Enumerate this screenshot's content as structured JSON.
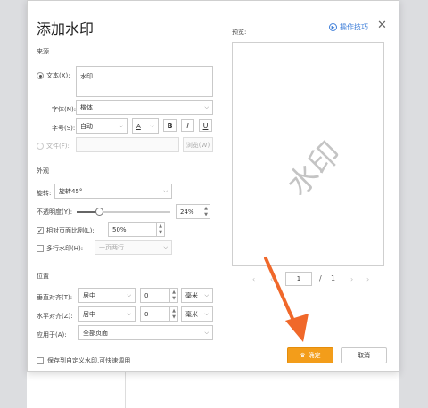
{
  "dialog": {
    "title": "添加水印",
    "help_label": "操作技巧",
    "close_glyph": "✕"
  },
  "source": {
    "section_label": "来源",
    "text_radio_label": "文本(X):",
    "text_value": "水印",
    "font_label": "字体(N):",
    "font_value": "楷体",
    "size_label": "字号(S):",
    "size_value": "自动",
    "color_glyph": "A",
    "bold": "B",
    "italic": "I",
    "underline": "U",
    "file_radio_label": "文件(F):",
    "browse_label": "浏览(W)"
  },
  "appearance": {
    "section_label": "外观",
    "rotate_label": "旋转:",
    "rotate_value": "旋转45°",
    "opacity_label": "不透明度(Y):",
    "opacity_value": "24%",
    "opacity_level": 24,
    "relative_label": "相对页面比例(L):",
    "relative_checked": true,
    "relative_value": "50%",
    "multi_label": "多行水印(H):",
    "multi_value": "一页两行"
  },
  "position": {
    "section_label": "位置",
    "vertical_label": "垂直对齐(T):",
    "vertical_value": "居中",
    "vertical_offset": "0",
    "vertical_unit": "毫米",
    "horizontal_label": "水平对齐(Z):",
    "horizontal_value": "居中",
    "horizontal_offset": "0",
    "horizontal_unit": "毫米",
    "apply_label": "应用于(A):",
    "apply_value": "全部页面"
  },
  "preview": {
    "label": "预览:",
    "watermark_text": "水印",
    "page_current": "1",
    "page_sep": "/",
    "page_total": "1",
    "prev_glyph": "‹",
    "next_glyph": "›"
  },
  "footer": {
    "save_label": "保存到自定义水印,可快速调用",
    "ok_label": "确定",
    "cancel_label": "取消"
  },
  "colors": {
    "accent": "#f39d1a",
    "link": "#3f7fd9",
    "arrow": "#f0682a"
  }
}
